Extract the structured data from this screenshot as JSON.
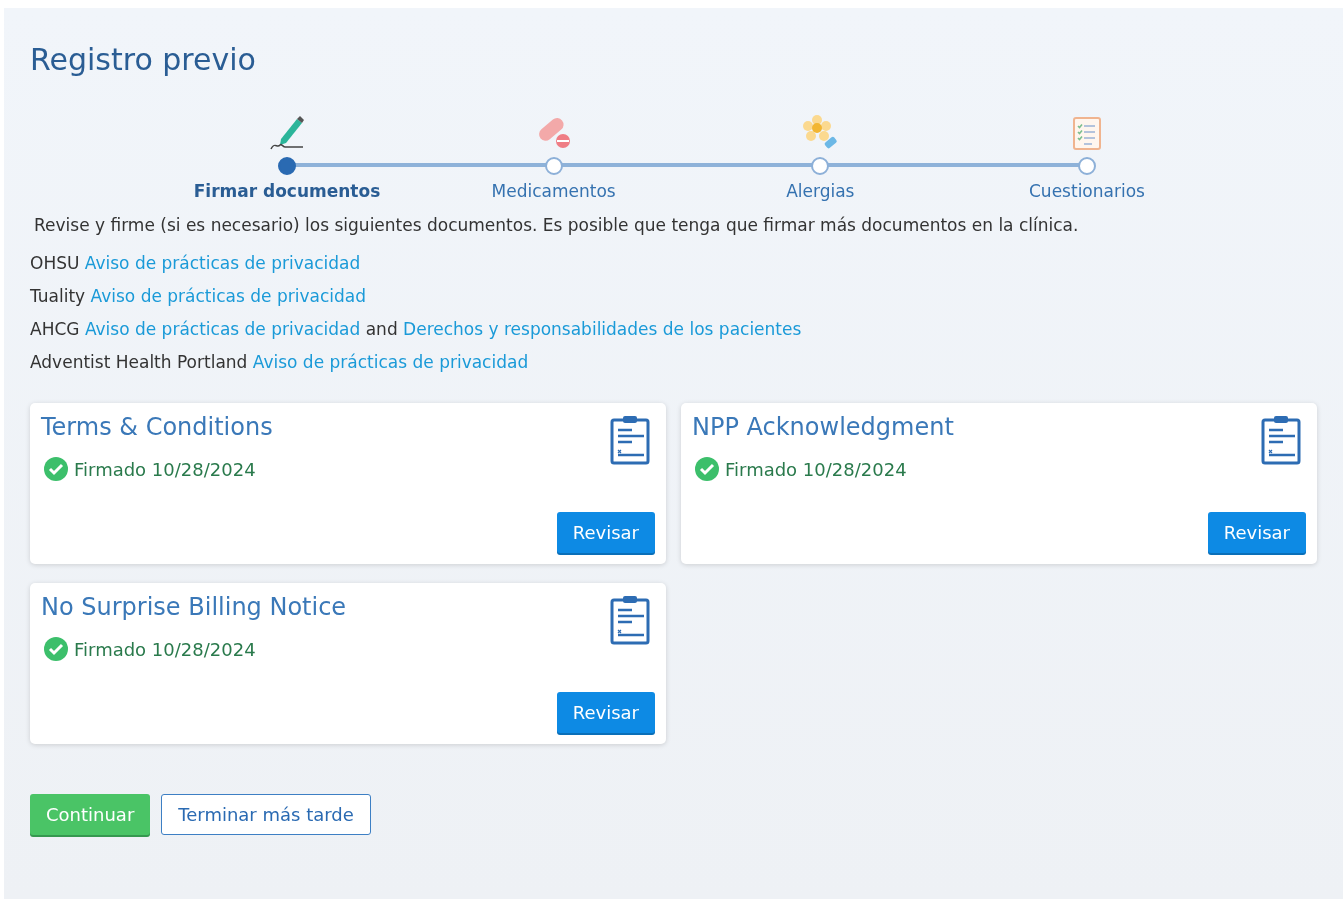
{
  "title": "Registro previo",
  "steps": [
    {
      "label": "Firmar documentos",
      "selected": true
    },
    {
      "label": "Medicamentos",
      "selected": false
    },
    {
      "label": "Alergias",
      "selected": false
    },
    {
      "label": "Cuestionarios",
      "selected": false
    }
  ],
  "intro": "Revise y firme (si es necesario) los siguientes documentos. Es posible que tenga que firmar más documentos en la clínica.",
  "document_lines": [
    [
      {
        "kind": "text",
        "text": "OHSU"
      },
      {
        "kind": "link",
        "text": "Aviso de prácticas de privacidad"
      }
    ],
    [
      {
        "kind": "text",
        "text": "Tuality"
      },
      {
        "kind": "link",
        "text": "Aviso de prácticas de privacidad"
      }
    ],
    [
      {
        "kind": "text",
        "text": "AHCG"
      },
      {
        "kind": "link",
        "text": "Aviso de prácticas de privacidad"
      },
      {
        "kind": "text",
        "text": "and"
      },
      {
        "kind": "link",
        "text": "Derechos y responsabilidades de los pacientes"
      }
    ],
    [
      {
        "kind": "text",
        "text": "Adventist Health Portland"
      },
      {
        "kind": "link",
        "text": "Aviso de prácticas de privacidad"
      }
    ]
  ],
  "cards": [
    {
      "title": "Terms & Conditions",
      "status": "Firmado 10/28/2024",
      "signed": true,
      "button": "Revisar"
    },
    {
      "title": "NPP Acknowledgment",
      "status": "Firmado 10/28/2024",
      "signed": true,
      "button": "Revisar"
    },
    {
      "title": "No Surprise Billing Notice",
      "status": "Firmado 10/28/2024",
      "signed": true,
      "button": "Revisar"
    }
  ],
  "buttons": [
    {
      "kind": "primary",
      "label": "Continuar"
    },
    {
      "kind": "secondary",
      "label": "Terminar más tarde"
    }
  ]
}
